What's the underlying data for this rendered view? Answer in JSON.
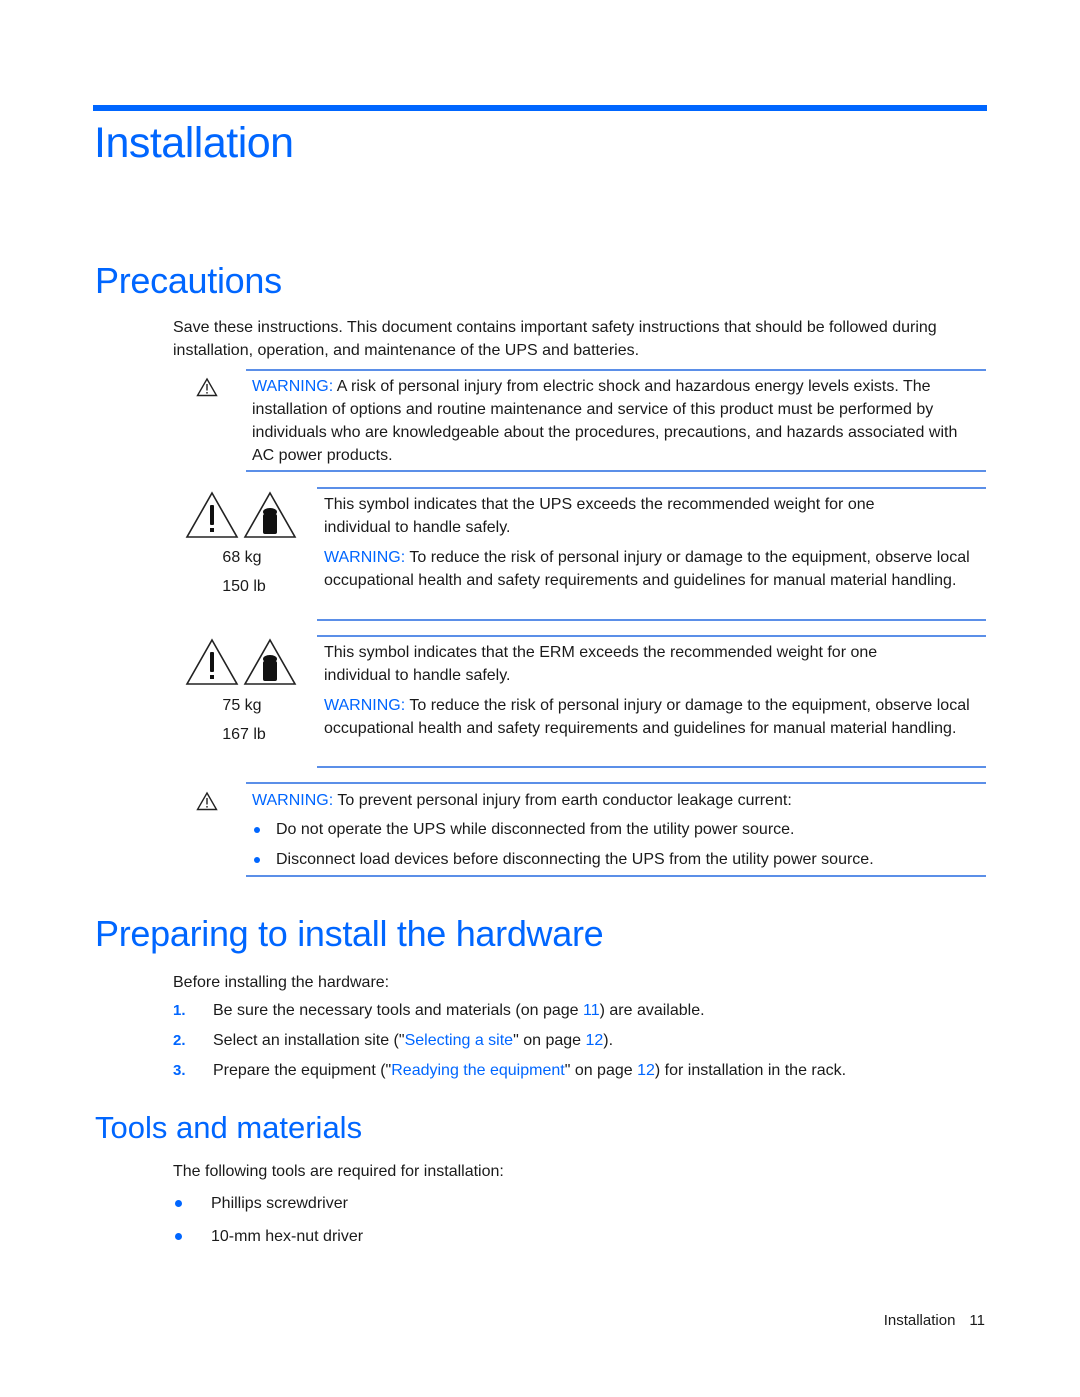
{
  "chapter_title": "Installation",
  "sections": {
    "precautions": {
      "title": "Precautions",
      "intro": "Save these instructions. This document contains important safety instructions that should be followed during installation, operation, and maintenance of the UPS and batteries.",
      "warning1": {
        "label": "WARNING:",
        "text": " A risk of personal injury from electric shock and hazardous energy levels exists. The installation of options and routine maintenance and service of this product must be performed by individuals who are knowledgeable about the procedures, precautions, and hazards associated with AC power products.",
        "icon": "warning-triangle-icon"
      },
      "weight_ups": {
        "icons": [
          "caution-triangle-icon",
          "heavy-weight-icon"
        ],
        "kg": "68 kg",
        "lb": "150 lb",
        "symbol_text": "This symbol indicates that the UPS exceeds the recommended weight for one individual to handle safely.",
        "warning_label": "WARNING:",
        "warning_text": " To reduce the risk of personal injury or damage to the equipment, observe local occupational health and safety requirements and guidelines for manual material handling."
      },
      "weight_erm": {
        "icons": [
          "caution-triangle-icon",
          "heavy-weight-icon"
        ],
        "kg": "75 kg",
        "lb": "167 lb",
        "symbol_text": "This symbol indicates that the ERM exceeds the recommended weight for one individual to handle safely.",
        "warning_label": "WARNING:",
        "warning_text": " To reduce the risk of personal injury or damage to the equipment, observe local occupational health and safety requirements and guidelines for manual material handling."
      },
      "warning2": {
        "label": "WARNING:",
        "text": " To prevent personal injury from earth conductor leakage current:",
        "icon": "warning-triangle-icon",
        "bullets": [
          "Do not operate the UPS while disconnected from the utility power source.",
          "Disconnect load devices before disconnecting the UPS from the utility power source."
        ]
      }
    },
    "preparing": {
      "title": "Preparing to install the hardware",
      "intro": "Before installing the hardware:",
      "steps": [
        {
          "num": "1.",
          "pre": "Be sure the necessary tools and materials (on page ",
          "link": "",
          "mid": "",
          "page": "11",
          "post": ") are available."
        },
        {
          "num": "2.",
          "pre": "Select an installation site (\"",
          "link": "Selecting a site",
          "mid": "\" on page ",
          "page": "12",
          "post": ")."
        },
        {
          "num": "3.",
          "pre": "Prepare the equipment (\"",
          "link": "Readying the equipment",
          "mid": "\" on page ",
          "page": "12",
          "post": ") for installation in the rack."
        }
      ]
    },
    "tools": {
      "title": "Tools and materials",
      "intro": "The following tools are required for installation:",
      "items": [
        "Phillips screwdriver",
        "10-mm hex-nut driver"
      ]
    }
  },
  "footer": {
    "section": "Installation",
    "page": "11"
  }
}
